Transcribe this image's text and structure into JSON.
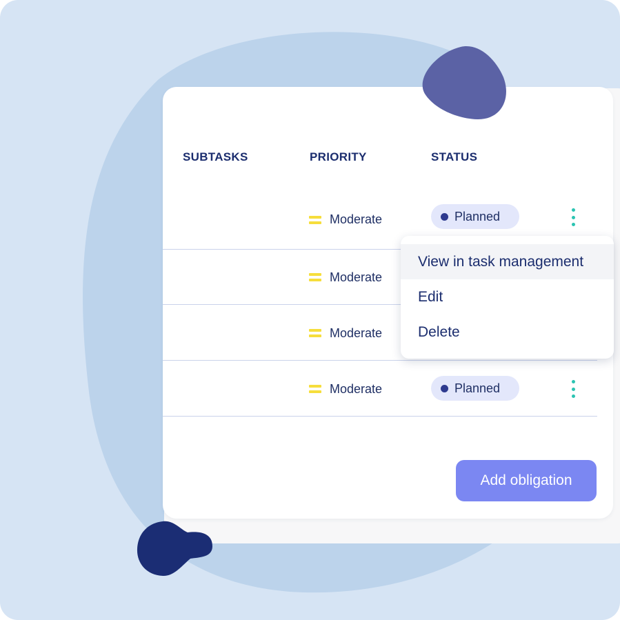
{
  "colors": {
    "background": "#d6e4f4",
    "blob": "#bcd3eb",
    "deco_purple": "#5b62a5",
    "deco_navy": "#1b2d74",
    "priority_moderate": "#f6de3c",
    "status_dot": "#2e3a8f",
    "status_pill": "#e3e7fb",
    "kebab": "#2bc4b2",
    "button": "#7b87f2",
    "text": "#1b2d6e"
  },
  "table": {
    "columns": [
      "SUBTASKS",
      "PRIORITY",
      "STATUS"
    ],
    "rows": [
      {
        "priority": "Moderate",
        "priority_icon": "equals-icon",
        "status": "Planned"
      },
      {
        "priority": "Moderate",
        "priority_icon": "equals-icon",
        "status": ""
      },
      {
        "priority": "Moderate",
        "priority_icon": "equals-icon",
        "status": ""
      },
      {
        "priority": "Moderate",
        "priority_icon": "equals-icon",
        "status": "Planned"
      }
    ]
  },
  "context_menu": {
    "items": [
      "View in task management",
      "Edit",
      "Delete"
    ]
  },
  "add_button": {
    "label": "Add obligation"
  }
}
